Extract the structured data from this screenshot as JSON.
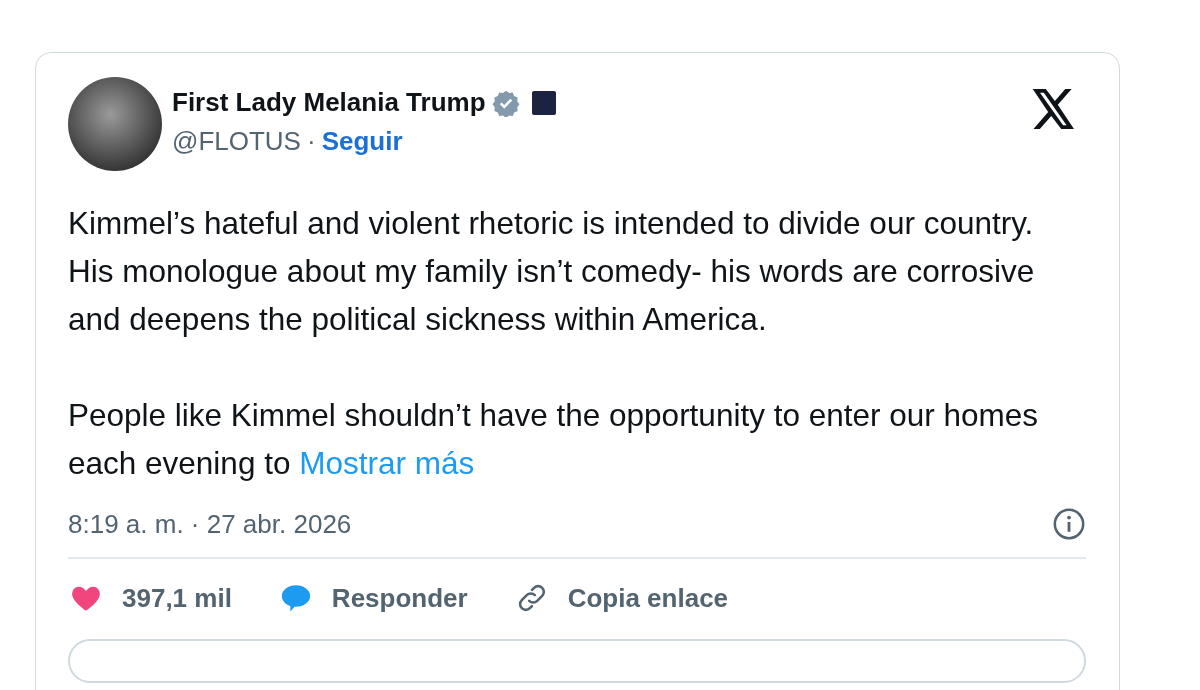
{
  "author": {
    "name": "First Lady Melania Trump",
    "verified": true,
    "handle": "@FLOTUS",
    "separator": "·",
    "follow": "Seguir"
  },
  "body": {
    "paragraphs": [
      "Kimmel’s hateful and violent rhetoric is intended to divide our country.  His monologue about my family isn’t comedy- his words are corrosive and deepens the political sickness within America.",
      "People like Kimmel shouldn’t have the opportunity to enter our homes each evening to"
    ],
    "more_link": "Mostrar más"
  },
  "timestamp": "8:19 a. m. · 27 abr. 2026",
  "actions": [
    {
      "kind": "like",
      "label": "397,1 mil"
    },
    {
      "kind": "reply",
      "label": "Responder"
    },
    {
      "kind": "copy-link",
      "label": "Copia enlace"
    }
  ]
}
